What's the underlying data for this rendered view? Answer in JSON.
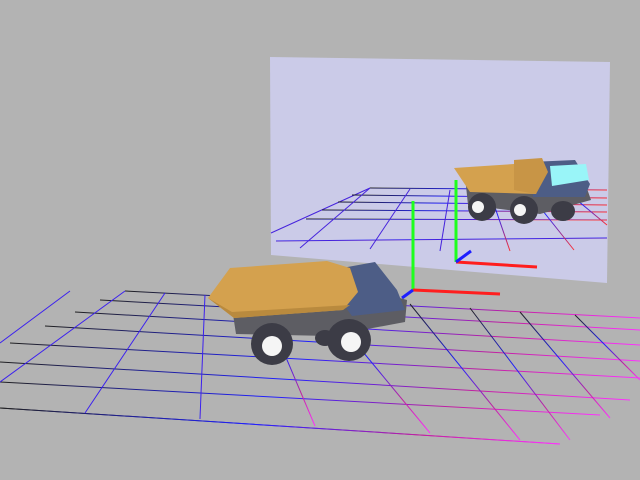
{
  "scene": {
    "background_color": "#b3b3b3",
    "mirror_panel_color": "#cbcbe8",
    "truck_bed_color": "#d4a14e",
    "truck_cab_color": "#4d5d86",
    "truck_chassis_color": "#5d5d63",
    "truck_window_color": "#99f5f8",
    "tire_color": "#3c3c46",
    "hubcap_color": "#f5f5f5",
    "axis_x_color": "#ff1e1e",
    "axis_y_color": "#1eff1e",
    "axis_z_color": "#1e1eff",
    "grid_color_start": "#202020",
    "grid_color_end": "#ff30ff"
  }
}
